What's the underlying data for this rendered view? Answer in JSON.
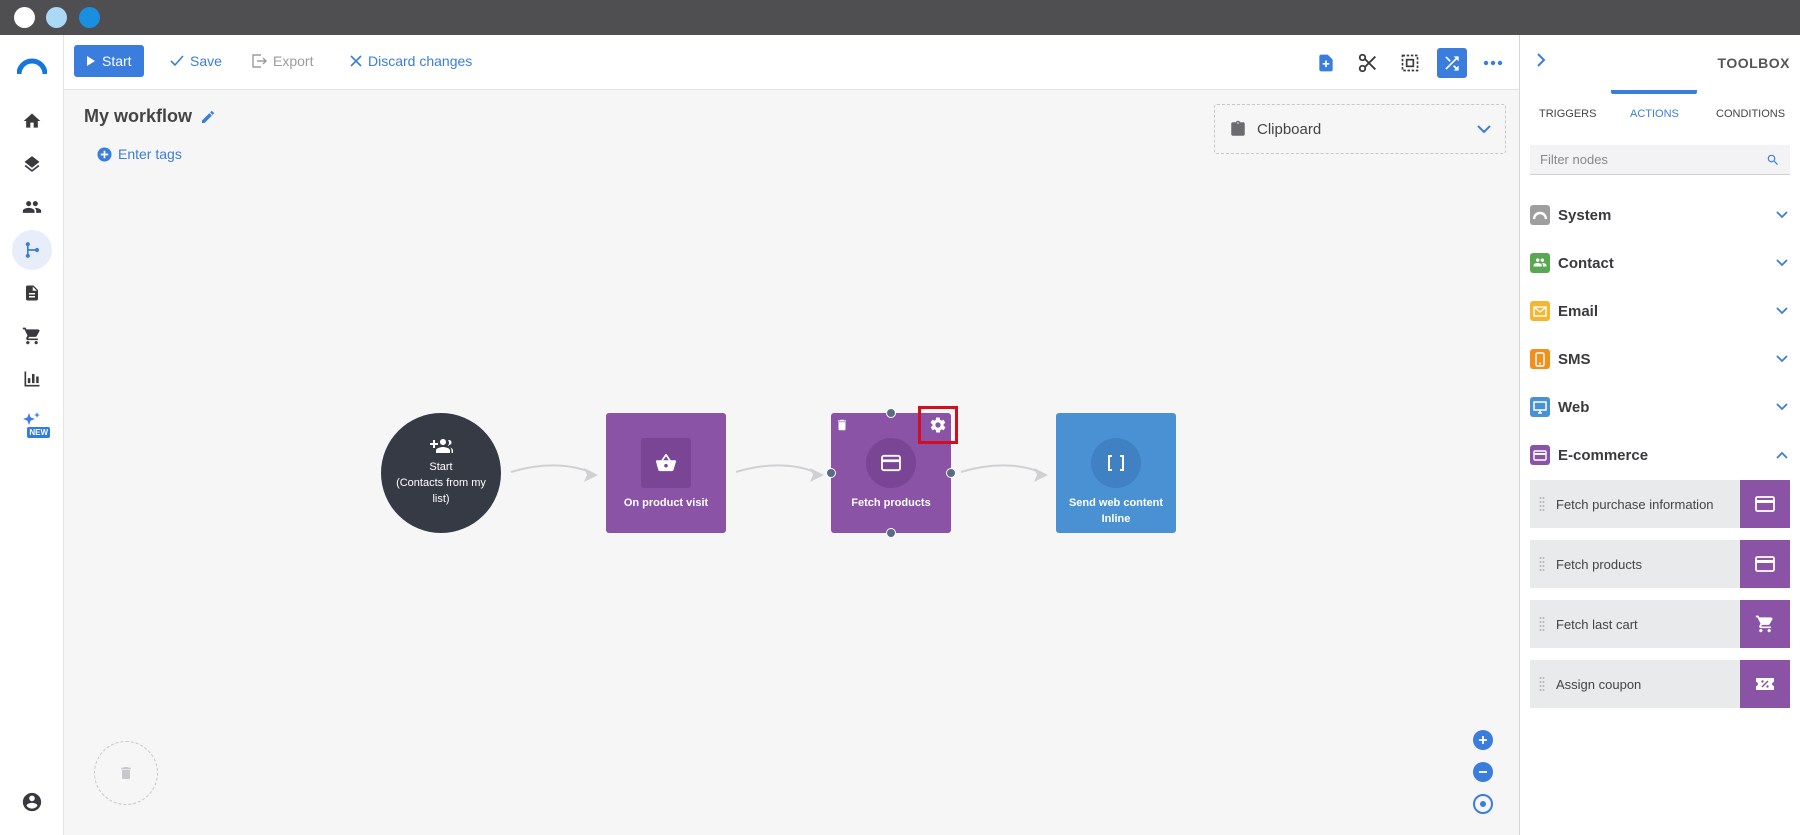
{
  "colors": {
    "accent": "#3b7ddd",
    "purple_node": "#8a53a6",
    "blue_node": "#4a91d4",
    "start_node": "#353a44",
    "highlight": "#d20f1f"
  },
  "toolbar": {
    "start_label": "Start",
    "save_label": "Save",
    "export_label": "Export",
    "discard_label": "Discard changes"
  },
  "workflow": {
    "title": "My workflow",
    "tags_label": "Enter tags"
  },
  "clipboard": {
    "label": "Clipboard"
  },
  "nodes": {
    "start": {
      "line1": "Start",
      "line2": "(Contacts from my list)"
    },
    "on_product_visit": {
      "label": "On product visit"
    },
    "fetch_products": {
      "label": "Fetch products"
    },
    "send_web_content": {
      "label": "Send web content Inline"
    }
  },
  "toolbox": {
    "title": "TOOLBOX",
    "tabs": [
      {
        "label": "TRIGGERS"
      },
      {
        "label": "ACTIONS"
      },
      {
        "label": "CONDITIONS"
      }
    ],
    "filter_placeholder": "Filter nodes",
    "categories": [
      {
        "label": "System",
        "color": "#9e9e9e",
        "icon": "system-icon"
      },
      {
        "label": "Contact",
        "color": "#5ba854",
        "icon": "contacts-icon"
      },
      {
        "label": "Email",
        "color": "#f2b631",
        "icon": "envelope-icon"
      },
      {
        "label": "SMS",
        "color": "#f1901c",
        "icon": "phone-icon"
      },
      {
        "label": "Web",
        "color": "#4a91d4",
        "icon": "monitor-icon"
      },
      {
        "label": "E-commerce",
        "color": "#8a53a6",
        "icon": "card-icon"
      }
    ],
    "ecommerce_actions": [
      {
        "label": "Fetch purchase information",
        "icon": "card-icon"
      },
      {
        "label": "Fetch products",
        "icon": "card-icon"
      },
      {
        "label": "Fetch last cart",
        "icon": "cart-icon"
      },
      {
        "label": "Assign coupon",
        "icon": "coupon-icon"
      }
    ]
  }
}
